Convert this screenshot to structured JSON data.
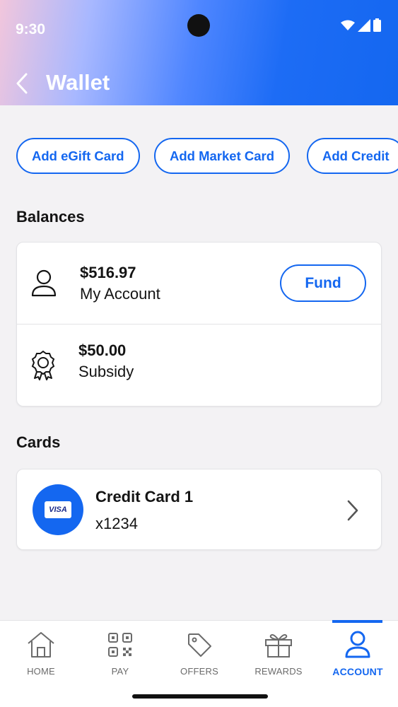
{
  "status_bar": {
    "time": "9:30"
  },
  "header": {
    "title": "Wallet"
  },
  "actions": [
    {
      "label": "Add eGift Card"
    },
    {
      "label": "Add Market Card"
    },
    {
      "label": "Add Credit"
    }
  ],
  "balances": {
    "title": "Balances",
    "items": [
      {
        "amount": "$516.97",
        "label": "My Account",
        "icon": "person-icon",
        "action": "Fund"
      },
      {
        "amount": "$50.00",
        "label": "Subsidy",
        "icon": "award-icon"
      }
    ]
  },
  "cards": {
    "title": "Cards",
    "items": [
      {
        "name": "Credit Card 1",
        "number": "x1234",
        "brand": "VISA"
      }
    ]
  },
  "nav": {
    "items": [
      {
        "label": "HOME",
        "icon": "home-icon"
      },
      {
        "label": "PAY",
        "icon": "qr-code-icon"
      },
      {
        "label": "OFFERS",
        "icon": "tag-icon"
      },
      {
        "label": "REWARDS",
        "icon": "gift-icon"
      },
      {
        "label": "ACCOUNT",
        "icon": "account-icon",
        "active": true
      }
    ]
  },
  "colors": {
    "accent": "#1467f0",
    "background": "#f3f2f4",
    "text": "#141414"
  }
}
